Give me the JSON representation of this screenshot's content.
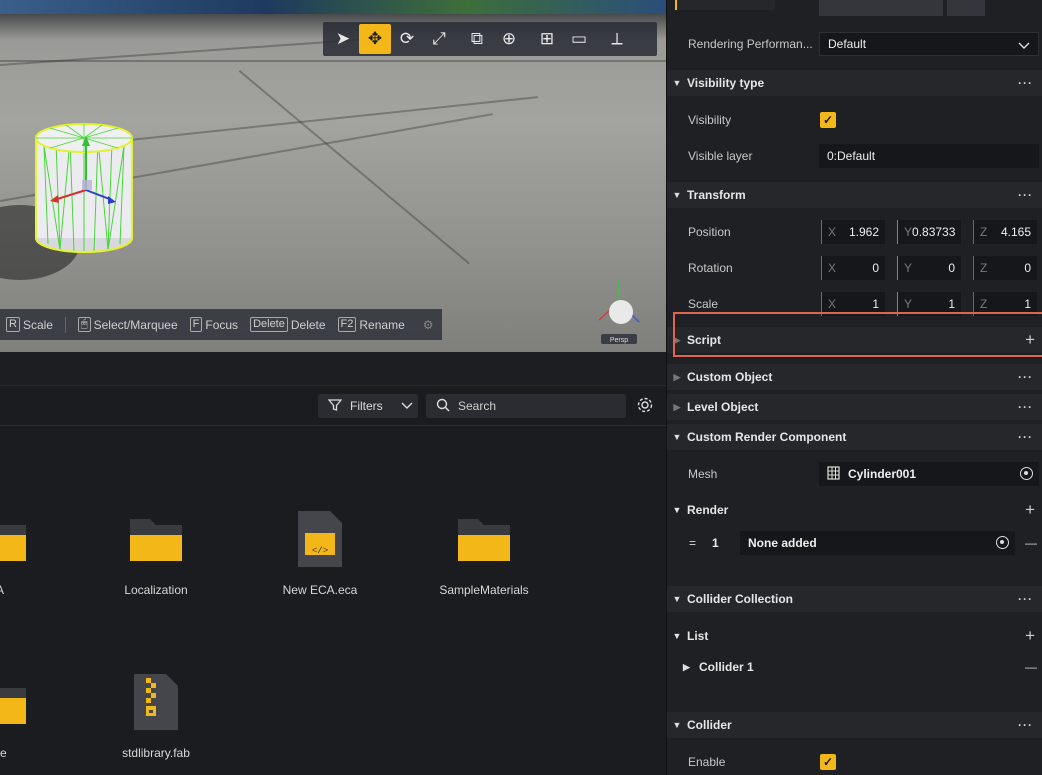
{
  "viewport": {
    "toolbar": {
      "tools": [
        {
          "name": "select-tool",
          "icon": "cursor-arrow-icon",
          "glyph": "➤",
          "active": false
        },
        {
          "name": "move-tool",
          "icon": "move-arrows-icon",
          "glyph": "✥",
          "active": true
        },
        {
          "name": "rotate-tool",
          "icon": "rotate-icon",
          "glyph": "⟳",
          "active": false
        },
        {
          "name": "scale-tool",
          "icon": "scale-icon",
          "glyph": "⤢",
          "active": false
        },
        {
          "name": "snap-tool",
          "icon": "snap-icon",
          "glyph": "⧉",
          "active": false
        },
        {
          "name": "world-local-tool",
          "icon": "globe-icon",
          "glyph": "⊕",
          "active": false
        },
        {
          "name": "grid-tool",
          "icon": "grid-icon",
          "glyph": "⊞",
          "active": false
        },
        {
          "name": "camera-tool",
          "icon": "camera-icon",
          "glyph": "▭",
          "active": false
        },
        {
          "name": "axis-tool",
          "icon": "axis-icon",
          "glyph": "⟂",
          "active": false
        }
      ],
      "accent": "#f4b718"
    },
    "shortcuts": [
      {
        "key": "R",
        "label": "Scale"
      },
      {
        "key": "🖱",
        "label": "Select/Marquee"
      },
      {
        "key": "F",
        "label": "Focus"
      },
      {
        "key": "Delete",
        "label": "Delete"
      },
      {
        "key": "F2",
        "label": "Rename"
      }
    ],
    "gizmo_label": "Persp"
  },
  "assets": {
    "filters_label": "Filters",
    "search_placeholder": "Search",
    "items": [
      {
        "label": "A",
        "icon": "folder-icon"
      },
      {
        "label": "Localization",
        "icon": "folder-icon"
      },
      {
        "label": "New ECA.eca",
        "icon": "eca-file-icon"
      },
      {
        "label": "SampleMaterials",
        "icon": "folder-icon"
      },
      {
        "label": "ne",
        "icon": "folder-icon"
      },
      {
        "label": "stdlibrary.fab",
        "icon": "zip-file-icon"
      }
    ]
  },
  "inspector": {
    "rendering_performance": {
      "label": "Rendering Performan...",
      "value": "Default"
    },
    "visibility_type": {
      "title": "Visibility type",
      "visibility_label": "Visibility",
      "visibility_checked": true,
      "visible_layer_label": "Visible layer",
      "visible_layer_value": "0:Default"
    },
    "transform": {
      "title": "Transform",
      "position": {
        "label": "Position",
        "x": "1.962",
        "y": "0.83733",
        "z": "4.165"
      },
      "rotation": {
        "label": "Rotation",
        "x": "0",
        "y": "0",
        "z": "0"
      },
      "scale": {
        "label": "Scale",
        "x": "1",
        "y": "1",
        "z": "1"
      },
      "axis_x": "X",
      "axis_y": "Y",
      "axis_z": "Z"
    },
    "script": {
      "title": "Script"
    },
    "custom_object": {
      "title": "Custom Object"
    },
    "level_object": {
      "title": "Level Object"
    },
    "custom_render": {
      "title": "Custom Render Component",
      "mesh_label": "Mesh",
      "mesh_value": "Cylinder001"
    },
    "render": {
      "title": "Render",
      "index": "1",
      "eq": "=",
      "value": "None added"
    },
    "collider_collection": {
      "title": "Collider Collection"
    },
    "list": {
      "title": "List",
      "child": "Collider 1"
    },
    "collider": {
      "title": "Collider",
      "enable_label": "Enable",
      "enable_checked": true
    },
    "more_glyph": "···",
    "plus_glyph": "+",
    "minus_glyph": "—",
    "check_glyph": "✓"
  }
}
